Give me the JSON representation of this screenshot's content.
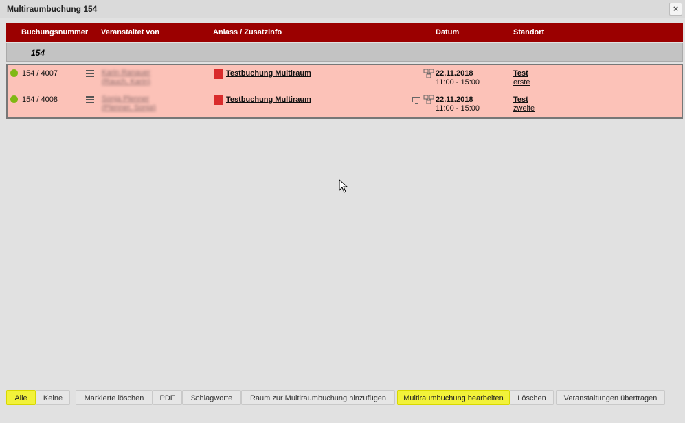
{
  "window": {
    "title": "Multiraumbuchung 154",
    "close_icon": "close-icon"
  },
  "table": {
    "headers": [
      "Buchungsnummer",
      "Veranstaltet von",
      "Anlass / Zusatzinfo",
      "Datum",
      "Standort"
    ],
    "group_label": "154",
    "rows": [
      {
        "status_color": "#80b814",
        "booking_number": "154 / 4007",
        "organizer_line1": "Karin Ranauer",
        "organizer_line2": "(Rauch, Karin)",
        "color": "#d92b2b",
        "anlass": "Testbuchung Multiraum",
        "icons": [
          "network-icon"
        ],
        "date": "22.11.2018",
        "time": "11:00 - 15:00",
        "location": "Test",
        "room": "erste"
      },
      {
        "status_color": "#80b814",
        "booking_number": "154 / 4008",
        "organizer_line1": "Sonja Plenner",
        "organizer_line2": "(Plenner, Sonja)",
        "color": "#d92b2b",
        "anlass": "Testbuchung Multiraum",
        "icons": [
          "monitor-icon",
          "network-icon"
        ],
        "date": "22.11.2018",
        "time": "11:00 - 15:00",
        "location": "Test",
        "room": "zweite"
      }
    ]
  },
  "toolbar": {
    "all": "Alle",
    "none": "Keine",
    "delete_marked": "Markierte löschen",
    "pdf": "PDF",
    "keywords": "Schlagworte",
    "add_room": "Raum zur Multiraumbuchung hinzufügen",
    "edit_multiroom": "Multiraumbuchung bearbeiten",
    "delete": "Löschen",
    "transfer_events": "Veranstaltungen übertragen"
  },
  "colors": {
    "header": "#9b0000",
    "row_bg": "#fcc2b8",
    "highlight": "#f2f23a"
  }
}
